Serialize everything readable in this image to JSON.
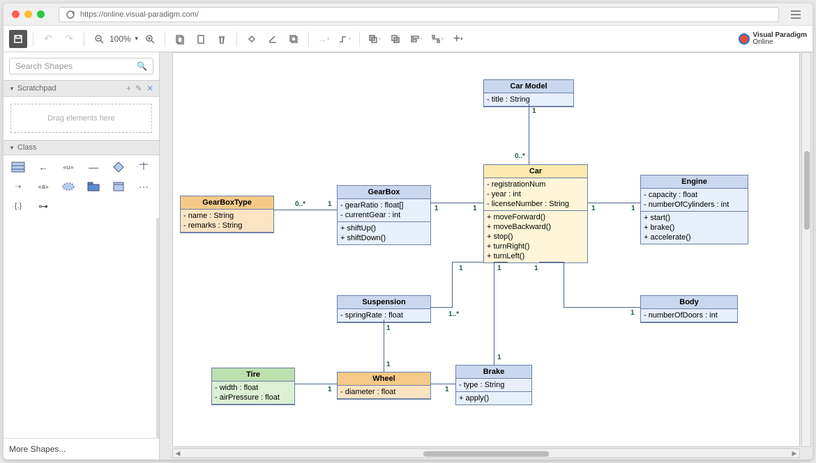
{
  "url": "https://online.visual-paradigm.com/",
  "zoom": "100%",
  "search_placeholder": "Search Shapes",
  "scratchpad_label": "Scratchpad",
  "drag_hint": "Drag elements here",
  "class_label": "Class",
  "more_shapes": "More Shapes...",
  "logo": {
    "line1": "Visual Paradigm",
    "line2": "Online"
  },
  "classes": {
    "carModel": {
      "name": "Car Model",
      "attrs": [
        "- title : String"
      ]
    },
    "car": {
      "name": "Car",
      "attrs": [
        "- registrationNum",
        "- year : int",
        "- licenseNumber : String"
      ],
      "ops": [
        "+ moveForward()",
        "+ moveBackward()",
        "+ stop()",
        "+ turnRight()",
        "+ turnLeft()"
      ]
    },
    "engine": {
      "name": "Engine",
      "attrs": [
        "- capacity : float",
        "- numberOfCylinders : int"
      ],
      "ops": [
        "+ start()",
        "+ brake()",
        "+ accelerate()"
      ]
    },
    "gearbox": {
      "name": "GearBox",
      "attrs": [
        "- gearRatio : float[]",
        "- currentGear : int"
      ],
      "ops": [
        "+ shiftUp()",
        "+ shiftDown()"
      ]
    },
    "gearboxType": {
      "name": "GearBoxType",
      "attrs": [
        "- name : String",
        "- remarks : String"
      ]
    },
    "suspension": {
      "name": "Suspension",
      "attrs": [
        "- springRate : float"
      ]
    },
    "body": {
      "name": "Body",
      "attrs": [
        "- numberOfDoors : int"
      ]
    },
    "wheel": {
      "name": "Wheel",
      "attrs": [
        "- diameter : float"
      ]
    },
    "tire": {
      "name": "Tire",
      "attrs": [
        "- width : float",
        "- airPressure : float"
      ]
    },
    "brake": {
      "name": "Brake",
      "attrs": [
        "- type : String"
      ],
      "ops": [
        "+ apply()"
      ]
    }
  },
  "mults": {
    "m1": "1",
    "m2": "0..*",
    "m3": "1",
    "m4": "1",
    "m5": "0..*",
    "m6": "1",
    "m7": "1",
    "m8": "1",
    "m9": "1",
    "m10": "1..*",
    "m11": "1",
    "m12": "1",
    "m13": "1",
    "m14": "1",
    "m15": "1",
    "m16": "1",
    "m17": "1"
  }
}
